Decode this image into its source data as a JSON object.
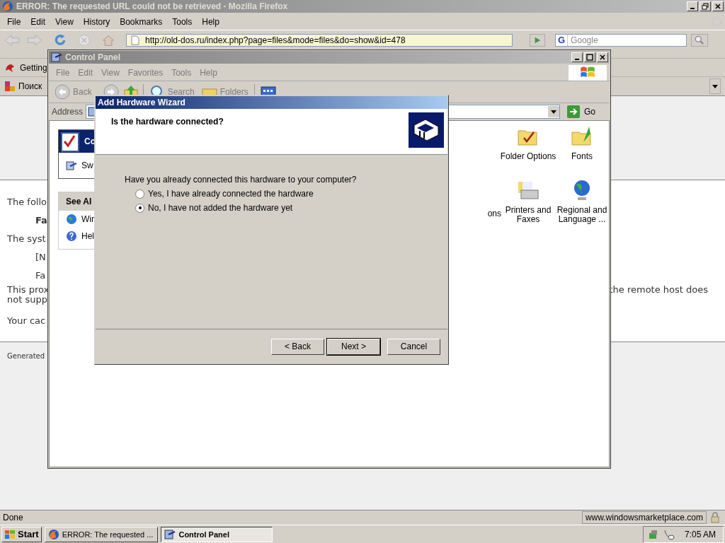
{
  "firefox": {
    "title": "ERROR: The requested URL could not be retrieved - Mozilla Firefox",
    "menu": [
      "File",
      "Edit",
      "View",
      "History",
      "Bookmarks",
      "Tools",
      "Help"
    ],
    "url": "http://old-dos.ru/index.php?page=files&mode=files&do=show&id=478",
    "search_engine": "G",
    "search_placeholder": "Google",
    "bookmarks": [
      "Getting"
    ],
    "tab_label": "Поиск",
    "status": "Done",
    "status_site": "www.windowsmarketplace.com"
  },
  "error_page": {
    "lines": [
      {
        "text": "The follo",
        "kind": "plain"
      },
      {
        "text": "Fa",
        "kind": "bold-indent"
      },
      {
        "text": "The syst",
        "kind": "plain"
      },
      {
        "text": "[N",
        "kind": "indent"
      },
      {
        "text": "Fa",
        "kind": "indent"
      }
    ],
    "proxy_lines": [
      "This prox",
      "not supp"
    ],
    "proxy_right": "the remote host does",
    "cache_line": "Your cac",
    "footer": "Generated"
  },
  "control_panel": {
    "title": "Control Panel",
    "menu": [
      "File",
      "Edit",
      "View",
      "Favorites",
      "Tools",
      "Help"
    ],
    "back": "Back",
    "search": "Search",
    "folders": "Folders",
    "address_label": "Address",
    "go": "Go",
    "tasks_title": "Co",
    "tasks": [
      "Sw"
    ],
    "see_also_title": "See Al",
    "see_also": [
      {
        "label": "Wir",
        "kind": "globe"
      },
      {
        "label": "Hel",
        "kind": "help"
      }
    ],
    "cut_label": "ons",
    "icons": [
      {
        "label": "Folder Options",
        "kind": "folder-check"
      },
      {
        "label": "Fonts",
        "kind": "folder-font"
      },
      {
        "label": "Printers and Faxes",
        "kind": "printer"
      },
      {
        "label": "Regional and Language ...",
        "kind": "globe"
      }
    ]
  },
  "wizard": {
    "title": "Add Hardware Wizard",
    "heading": "Is the hardware connected?",
    "question": "Have you already connected this hardware to your computer?",
    "options": [
      {
        "label": "Yes, I have already connected the hardware",
        "selected": false
      },
      {
        "label": "No, I have not added the hardware yet",
        "selected": true
      }
    ],
    "buttons": [
      {
        "label": "< Back",
        "kind": "normal"
      },
      {
        "label": "Next >",
        "kind": "default"
      },
      {
        "label": "Cancel",
        "kind": "normal"
      }
    ]
  },
  "taskbar": {
    "start": "Start",
    "tasks": [
      {
        "label": "ERROR: The requested ...",
        "kind": "browser",
        "selected": false
      },
      {
        "label": "Control Panel",
        "kind": "control-panel",
        "selected": true
      }
    ],
    "clock": "7:05 AM"
  }
}
